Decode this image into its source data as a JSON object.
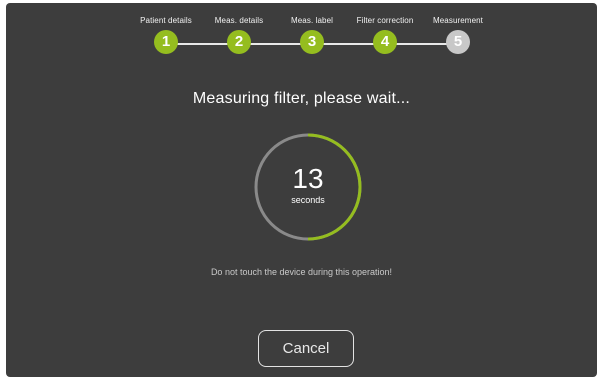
{
  "stepper": {
    "steps": [
      {
        "label": "Patient details",
        "number": "1",
        "state": "done"
      },
      {
        "label": "Meas. details",
        "number": "2",
        "state": "done"
      },
      {
        "label": "Meas. label",
        "number": "3",
        "state": "done"
      },
      {
        "label": "Filter correction",
        "number": "4",
        "state": "done"
      },
      {
        "label": "Measurement",
        "number": "5",
        "state": "pending"
      }
    ]
  },
  "main": {
    "title": "Measuring filter, please wait...",
    "timer_value": "13",
    "timer_unit": "seconds",
    "progress_fraction": 0.5,
    "warning": "Do not touch the device during this operation!"
  },
  "actions": {
    "cancel_label": "Cancel"
  },
  "colors": {
    "background": "#3d3d3d",
    "accent": "#95bd1f",
    "pending": "#c8c8c8",
    "ring_track": "#8a8a8a"
  }
}
